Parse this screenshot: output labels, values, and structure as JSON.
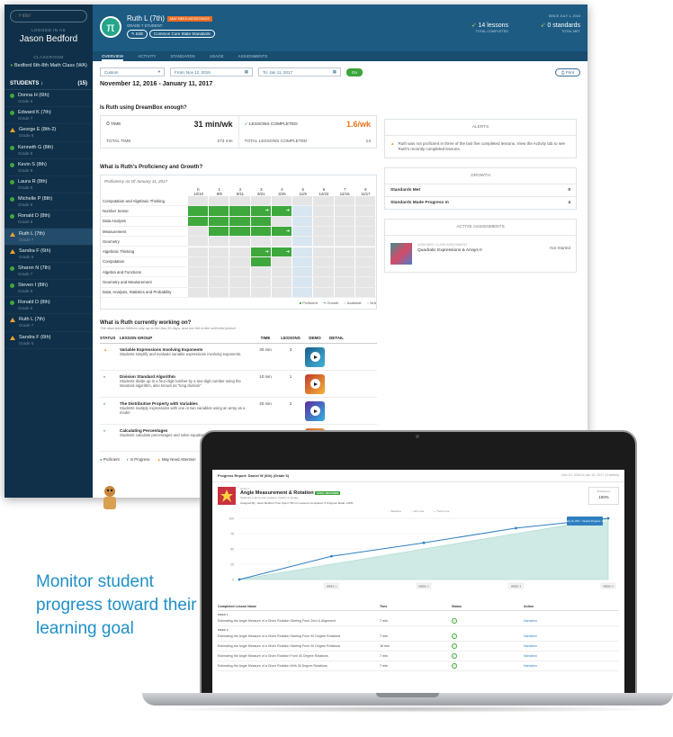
{
  "sidebar": {
    "search_placeholder": "Filter",
    "logged_in_as": "LOGGED IN AS",
    "teacher_name": "Jason Bedford",
    "classroom_label": "CLASSROOM",
    "classroom_name": "Bedford 6th-8th Math Class (WA)",
    "students_header": "STUDENTS",
    "students_count": "(15)",
    "students": [
      {
        "name": "Donna H (6th)",
        "grade": "Grade 6",
        "status": "green"
      },
      {
        "name": "Edward K (7th)",
        "grade": "Grade 7",
        "status": "green"
      },
      {
        "name": "George E (8th-2)",
        "grade": "Grade 8",
        "status": "warning"
      },
      {
        "name": "Kenneth G (8th)",
        "grade": "Grade 8",
        "status": "green"
      },
      {
        "name": "Kevin S (8th)",
        "grade": "Grade 8",
        "status": "green"
      },
      {
        "name": "Laura R (8th)",
        "grade": "Grade 8",
        "status": "green"
      },
      {
        "name": "Michelle P (8th)",
        "grade": "Grade 8",
        "status": "green"
      },
      {
        "name": "Ronald D (8th)",
        "grade": "Grade 8",
        "status": "green"
      },
      {
        "name": "Ruth L (7th)",
        "grade": "Grade 7",
        "status": "warning",
        "selected": true
      },
      {
        "name": "Sandra F (6th)",
        "grade": "Grade 6",
        "status": "warning"
      },
      {
        "name": "Sharon N (7th)",
        "grade": "Grade 7",
        "status": "green"
      },
      {
        "name": "Steven I (8th)",
        "grade": "Grade 8",
        "status": "green"
      },
      {
        "name": "Ronald D (8th)",
        "grade": "Grade 8",
        "status": "green"
      },
      {
        "name": "Ruth L (7th)",
        "grade": "Grade 7",
        "status": "warning"
      },
      {
        "name": "Sandra F (6th)",
        "grade": "Grade 6",
        "status": "warning"
      }
    ]
  },
  "header": {
    "student_name": "Ruth L (7th)",
    "badge": "MAY NEED ASSISTANCE",
    "grade": "GRADE 7 STUDENT",
    "edit_label": "Edit",
    "standards_button": "Common Core State Standards",
    "lessons_value": "14 lessons",
    "lessons_caption": "TOTAL COMPLETED",
    "standards_value": "0 standards",
    "standards_caption": "TOTAL MET",
    "since": "SINCE JULY 1, 2016"
  },
  "tabs": [
    "OVERVIEW",
    "ACTIVITY",
    "STANDARDS",
    "USAGE",
    "ASSIGNMENTS"
  ],
  "filters": {
    "view": "Custom",
    "from": "From: Nov 12, 2016",
    "to": "To: Jan 11, 2017",
    "go": "Go",
    "print": "Print"
  },
  "date_range": "November 12, 2016 - January 11, 2017",
  "usage": {
    "question": "Is Ruth using DreamBox enough?",
    "time_label": "TIME",
    "time_value": "31 min/wk",
    "lessons_label": "LESSONS COMPLETED",
    "lessons_value": "1.6/wk",
    "total_time_label": "TOTAL TIME",
    "total_time_value": "273 min",
    "total_lessons_label": "TOTAL LESSONS COMPLETED",
    "total_lessons_value": "14"
  },
  "proficiency": {
    "question": "What is Ruth's Proficiency and Growth?",
    "as_of": "Proficiency As Of January 11, 2017",
    "columns": [
      [
        "K",
        "10/10"
      ],
      [
        "1",
        "9/9"
      ],
      [
        "2",
        "8/11"
      ],
      [
        "3",
        "9/21"
      ],
      [
        "4",
        "3/26"
      ],
      [
        "5",
        "11/9"
      ],
      [
        "6",
        "12/22"
      ],
      [
        "7",
        "12/16"
      ],
      [
        "8",
        "11/17"
      ]
    ],
    "rows": [
      {
        "label": "Computation and Algebraic Thinking",
        "cells": [
          "N",
          "N",
          "N",
          "N",
          "N",
          "N",
          "N",
          "N",
          "N"
        ]
      },
      {
        "label": "Number Sense",
        "cells": [
          "P",
          "P",
          "P",
          "G",
          "G",
          "A",
          "N",
          "N",
          "N"
        ]
      },
      {
        "label": "Data Analysis",
        "cells": [
          "P",
          "P",
          "P",
          "P",
          "N",
          "A",
          "N",
          "N",
          "N"
        ]
      },
      {
        "label": "Measurement",
        "cells": [
          "N",
          "P",
          "P",
          "P",
          "G",
          "A",
          "N",
          "N",
          "N"
        ]
      },
      {
        "label": "Geometry",
        "cells": [
          "N",
          "N",
          "N",
          "N",
          "N",
          "A",
          "N",
          "N",
          "N"
        ]
      },
      {
        "label": "Algebraic Thinking",
        "cells": [
          "N",
          "N",
          "N",
          "G",
          "G",
          "A",
          "N",
          "N",
          "N"
        ]
      },
      {
        "label": "Computation",
        "cells": [
          "N",
          "N",
          "N",
          "P",
          "N",
          "A",
          "N",
          "N",
          "N"
        ]
      },
      {
        "label": "Algebra and Functions",
        "cells": [
          "N",
          "N",
          "N",
          "N",
          "N",
          "A",
          "N",
          "N",
          "N"
        ]
      },
      {
        "label": "Geometry and Measurement",
        "cells": [
          "N",
          "N",
          "N",
          "N",
          "N",
          "A",
          "N",
          "N",
          "N"
        ]
      },
      {
        "label": "Data, Analysis, Statistics and Probability",
        "cells": [
          "N",
          "N",
          "N",
          "N",
          "N",
          "A",
          "N",
          "N",
          "N"
        ]
      }
    ],
    "legend": [
      "Proficient",
      "Growth",
      "Available",
      "N/A"
    ],
    "colors": {
      "proficient": "#3ea83c",
      "available": "#d7e6f1",
      "na": "#e5e5e5"
    }
  },
  "current_work": {
    "question": "What is Ruth currently working on?",
    "subtitle": "The data below reflects only up to the last 30 days, and not the entire selected period",
    "headers": [
      "STATUS",
      "LESSON GROUP",
      "TIME",
      "LESSONS",
      "DEMO",
      "DETAIL"
    ],
    "rows": [
      {
        "status": "warning",
        "title": "Variable Expressions Involving Exponents",
        "desc": "Students simplify and evaluate variable expressions involving exponents.",
        "time": "30 min",
        "lessons": "3"
      },
      {
        "status": "progress",
        "title": "Division Standard Algorithm",
        "desc": "Students divide up to a four-digit number by a two-digit number using the standard algorithm, also known as \"long division\"",
        "time": "10 min",
        "lessons": "1"
      },
      {
        "status": "progress",
        "title": "The Distributive Property with Variables",
        "desc": "Students multiply expressions with one or two variables using an array as a model",
        "time": "20 min",
        "lessons": "2"
      },
      {
        "status": "progress",
        "title": "Calculating Percentages",
        "desc": "Students calculate percentages and solve equations",
        "time": "",
        "lessons": ""
      }
    ],
    "legend": [
      "Proficient",
      "In Progress",
      "May Need Attention"
    ]
  },
  "alerts": {
    "title": "ALERTS",
    "text": "Ruth was not proficient in three of the last five completed lessons. View the Activity tab to see Ruth's recently completed lessons."
  },
  "growth": {
    "title": "GROWTH",
    "rows": [
      {
        "label": "Standards Met",
        "value": "0"
      },
      {
        "label": "Standards Made Progress In",
        "value": "4"
      }
    ]
  },
  "assignments": {
    "title": "ACTIVE ASSIGNMENTS",
    "meta": "ASSIGNED: CLASS ASSIGNMENT",
    "name": "Quadratic Expressions & Arrays II",
    "status": "Not Started"
  },
  "caption": "Monitor student progress toward their learning goal",
  "laptop": {
    "report_title": "Progress Report: Daniel W (6th) (Grade 6)",
    "report_dates": "Dec 10, 2016 to Jan 10, 2017 (4 weeks)",
    "goal_small": "GOAL 1",
    "goal_title": "Angle Measurement & Rotation",
    "goal_badge": "GOAL REACHED",
    "goal_desc": "Students explore and measure rotation of angles",
    "assigned_meta": "Assigned By: Jason Bedford   Time Spent: 58 min   Lessons Completed: 5   Progress Made: 100%",
    "proficiency_label": "Proficiency",
    "proficiency_value": "100%",
    "chart_legend": [
      "Baseline",
      "Aim Line",
      "Trend Line"
    ],
    "tooltip": "January 10, 2017 · Student Progress: 100%",
    "completed_header": [
      "Completed Lesson Name",
      "Time",
      "Status",
      "Action"
    ],
    "weeks": [
      "WEEK 1",
      "WEEK 2",
      "WEEK 3",
      "WEEK 4"
    ],
    "lessons": [
      {
        "week": "WEEK 1",
        "name": "Estimating the Angle Measure of a Given Rotation Starting From Zero & Alignment",
        "time": "7 min",
        "action": "Narration"
      },
      {
        "week": "WEEK 2",
        "name": "Estimating the Angle Measure of a Given Rotation Starting From 90 Degree Rotations",
        "time": "7 min",
        "action": "Narration"
      },
      {
        "week": "",
        "name": "Estimating the Angle Measure of a Given Rotation Starting From 90 Degree Rotations",
        "time": "16 min",
        "action": "Narration"
      },
      {
        "week": "",
        "name": "Estimating the Angle Measure of a Given Rotation From 45 Degree Rotations",
        "time": "7 min",
        "action": "Narration"
      },
      {
        "week": "",
        "name": "Estimating the Angle Measure of a Given Rotation With 30 Degree Rotations",
        "time": "7 min",
        "action": "Narration"
      }
    ]
  },
  "chart_data": {
    "type": "line",
    "title": "",
    "xlabel": "",
    "ylabel": "",
    "x": [
      "Start",
      "WEEK 1",
      "WEEK 2",
      "WEEK 3",
      "WEEK 4"
    ],
    "ylim": [
      0,
      100
    ],
    "series": [
      {
        "name": "Aim Line",
        "values": [
          0,
          25,
          50,
          75,
          100
        ]
      },
      {
        "name": "Trend Line",
        "values": [
          0,
          38,
          60,
          84,
          100
        ]
      }
    ],
    "y_ticks": [
      0,
      25,
      50,
      75,
      100
    ],
    "colors": {
      "aim_fill": "#cfe9e4",
      "trend": "#2f7fc0"
    }
  }
}
